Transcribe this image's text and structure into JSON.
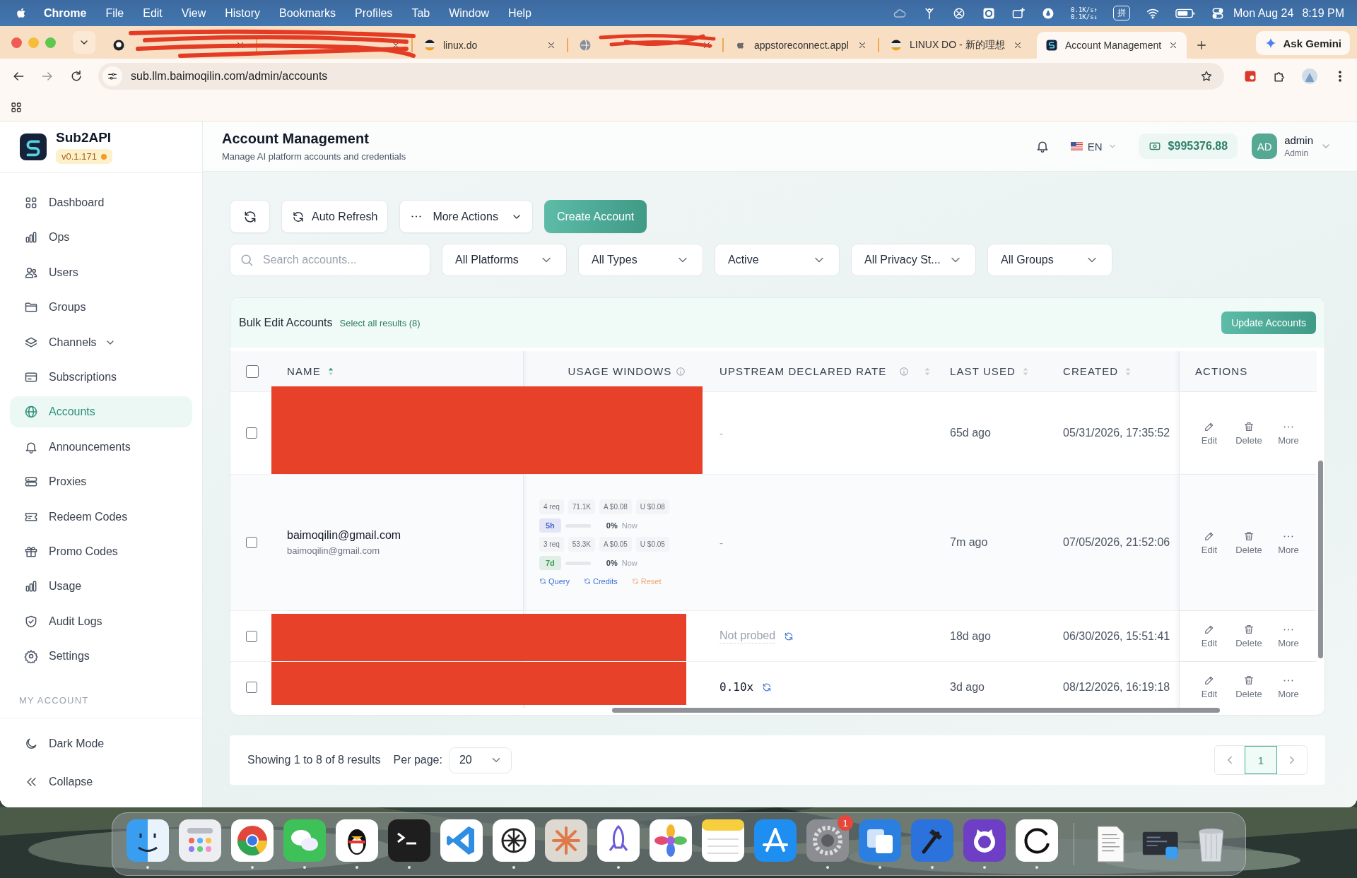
{
  "menubar": {
    "app": "Chrome",
    "menus": [
      "File",
      "Edit",
      "View",
      "History",
      "Bookmarks",
      "Profiles",
      "Tab",
      "Window",
      "Help"
    ],
    "net_speed": [
      "0.1K/s↑",
      "0.1K/s↓"
    ],
    "input_method": "拼",
    "date": "Mon Aug 24",
    "time": "8:19 PM"
  },
  "browser": {
    "tabs": [
      {
        "kind": "scribbled",
        "selected": false
      },
      {
        "kind": "scribbled",
        "selected": false
      },
      {
        "kind": "page",
        "title": "linux.do",
        "selected": false
      },
      {
        "kind": "scribbled",
        "selected": false
      },
      {
        "kind": "page",
        "title": "appstoreconnect.appl",
        "selected": false
      },
      {
        "kind": "page",
        "title": "LINUX DO - 新的理想",
        "selected": false
      },
      {
        "kind": "page",
        "title": "Account Management",
        "selected": true
      }
    ],
    "gemini": "Ask Gemini",
    "url": "sub.llm.baimoqilin.com/admin/accounts"
  },
  "sidebar": {
    "brand": "Sub2API",
    "version": "v0.1.171",
    "nav": [
      {
        "label": "Dashboard",
        "selected": false,
        "expandable": false
      },
      {
        "label": "Ops",
        "selected": false,
        "expandable": false
      },
      {
        "label": "Users",
        "selected": false,
        "expandable": false
      },
      {
        "label": "Groups",
        "selected": false,
        "expandable": false
      },
      {
        "label": "Channels",
        "selected": false,
        "expandable": true
      },
      {
        "label": "Subscriptions",
        "selected": false,
        "expandable": false
      },
      {
        "label": "Accounts",
        "selected": true,
        "expandable": false
      },
      {
        "label": "Announcements",
        "selected": false,
        "expandable": false
      },
      {
        "label": "Proxies",
        "selected": false,
        "expandable": false
      },
      {
        "label": "Redeem Codes",
        "selected": false,
        "expandable": false
      },
      {
        "label": "Promo Codes",
        "selected": false,
        "expandable": false
      },
      {
        "label": "Usage",
        "selected": false,
        "expandable": false
      },
      {
        "label": "Audit Logs",
        "selected": false,
        "expandable": false
      },
      {
        "label": "Settings",
        "selected": false,
        "expandable": false
      }
    ],
    "section": "MY ACCOUNT",
    "bottom": [
      "Dark Mode",
      "Collapse"
    ]
  },
  "header": {
    "title": "Account Management",
    "subtitle": "Manage AI platform accounts and credentials",
    "language": "EN",
    "balance": "$995376.88",
    "avatar": "AD",
    "user": "admin",
    "role": "Admin"
  },
  "toolbar": {
    "buttons": [
      {
        "kind": "icon"
      },
      {
        "kind": "refresh",
        "label": "Auto Refresh"
      },
      {
        "kind": "menu",
        "label": "More Actions"
      },
      {
        "kind": "primary",
        "label": "Create Account"
      }
    ]
  },
  "filters": {
    "search": {
      "placeholder": "Search accounts..."
    },
    "selects": [
      "All Platforms",
      "All Types",
      "Active",
      "All Privacy St...",
      "All Groups"
    ]
  },
  "bulk": {
    "title": "Bulk Edit Accounts",
    "select_all": "Select all results (8)",
    "action": "Update Accounts"
  },
  "table": {
    "select_all_checked": false,
    "columns": [
      {
        "label": "NAME",
        "sortable": true,
        "sorted": true
      },
      {
        "label": "USAGE WINDOWS",
        "info": true
      },
      {
        "label": "UPSTREAM DECLARED RATE",
        "sortable": true,
        "sorted": false,
        "info": true
      },
      {
        "label": "LAST USED",
        "sortable": true,
        "sorted": false
      },
      {
        "label": "CREATED",
        "sortable": true,
        "sorted": false
      },
      {
        "label": "ACTIONS"
      }
    ],
    "rows": [
      {
        "kind": "redacted",
        "checked": false,
        "rate": {
          "kind": "text",
          "text": "-"
        },
        "last_used": "65d ago",
        "created": "05/31/2026, 17:35:52",
        "actions": [
          "Edit",
          "Delete",
          "More"
        ]
      },
      {
        "kind": "account",
        "checked": false,
        "name": "baimoqilin@gmail.com",
        "email": "baimoqilin@gmail.com",
        "usage": {
          "windows": [
            {
              "stats": [
                "4 req",
                "71.1K",
                "A $0.08",
                "U $0.08"
              ],
              "label": "5h",
              "color": "#4f63d2",
              "level": 0,
              "percent": "0%",
              "reset": "Now"
            },
            {
              "stats": [
                "3 req",
                "53.3K",
                "A $0.05",
                "U $0.05"
              ],
              "label": "7d",
              "color": "#3b9a5c",
              "level": 0,
              "percent": "0%",
              "reset": "Now"
            }
          ],
          "links": [
            {
              "kind": "link",
              "label": "Query"
            },
            {
              "kind": "link",
              "label": "Credits"
            },
            {
              "kind": "warn",
              "label": "Reset"
            }
          ]
        },
        "rate": {
          "kind": "text",
          "text": "-"
        },
        "last_used": "7m ago",
        "created": "07/05/2026, 21:52:06",
        "actions": [
          "Edit",
          "Delete",
          "More"
        ]
      },
      {
        "kind": "redacted",
        "checked": false,
        "rate": {
          "kind": "probe",
          "text": "Not probed"
        },
        "last_used": "18d ago",
        "created": "06/30/2026, 15:51:41",
        "actions": [
          "Edit",
          "Delete",
          "More"
        ]
      },
      {
        "kind": "redacted",
        "checked": false,
        "rate": {
          "kind": "value",
          "text": "0.10x"
        },
        "last_used": "3d ago",
        "created": "08/12/2026, 16:19:18",
        "actions": [
          "Edit",
          "Delete",
          "More"
        ]
      }
    ]
  },
  "footer": {
    "summary": "Showing 1 to 8 of 8 results",
    "per_page_label": "Per page:",
    "per_page": "20",
    "pages": [
      {
        "label": "1",
        "selected": true
      }
    ]
  },
  "dock": {
    "apps": [
      {
        "running": true
      },
      {
        "running": false
      },
      {
        "running": true
      },
      {
        "running": true
      },
      {
        "running": true
      },
      {
        "running": true
      },
      {
        "running": false
      },
      {
        "running": true
      },
      {
        "running": false
      },
      {
        "running": true
      },
      {
        "running": false
      },
      {
        "running": false
      },
      {
        "running": false
      },
      {
        "running": true,
        "badge": "1"
      },
      {
        "running": true
      },
      {
        "running": true
      },
      {
        "running": true
      },
      {
        "running": true
      }
    ]
  }
}
